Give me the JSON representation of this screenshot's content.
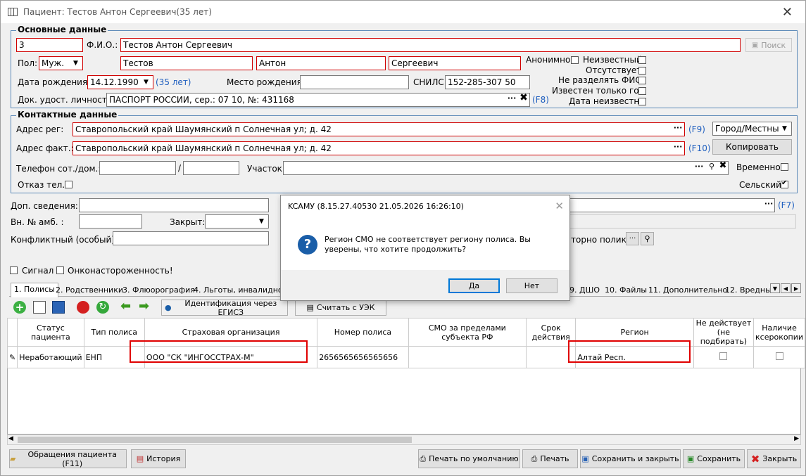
{
  "window": {
    "title": "Пациент: Тестов Антон Сергеевич(35 лет)"
  },
  "main_group": {
    "label": "Основные данные",
    "id_value": "3",
    "fio_label": "Ф.И.О.:",
    "fio_value": "Тестов Антон Сергеевич",
    "search_button": "Поиск",
    "sex_label": "Пол:",
    "sex_value": "Муж.",
    "last_name": "Тестов",
    "first_name": "Антон",
    "middle_name": "Сергеевич",
    "birth_label": "Дата рождения:",
    "birth_value": "14.12.1990",
    "age": "(35 лет)",
    "birthplace_label": "Место рождения:",
    "birthplace_value": "",
    "snils_label": "СНИЛС:",
    "snils_value": "152-285-307 50",
    "doc_label": "Док. удост. личность:",
    "doc_value": "ПАСПОРТ РОССИИ, сер.: 07 10, №: 431168",
    "doc_hotkey": "(F8)",
    "flags": {
      "anonymous": "Анонимно",
      "unknown": "Неизвестный",
      "absent": "Отсутствует",
      "no_split_fio": "Не разделять ФИО",
      "year_only": "Известен только год",
      "date_unknown": "Дата неизвестна"
    }
  },
  "contact_group": {
    "label": "Контактные данные",
    "addr_reg_label": "Адрес рег:",
    "addr_reg_value": "Ставропольский край Шаумянский п Солнечная ул; д. 42",
    "addr_reg_hotkey": "(F9)",
    "city_select": "Город/Местный",
    "addr_fact_label": "Адрес факт.:",
    "addr_fact_value": "Ставропольский край Шаумянский п Солнечная ул; д. 42",
    "addr_fact_hotkey": "(F10)",
    "copy_button": "Копировать",
    "phone_label": "Телефон сот./дом.:",
    "phone_sep": "/",
    "district_label": "Участок:",
    "temporary_label": "Временно",
    "refuse_phone_label": "Отказ тел.",
    "rural_label": "Сельский"
  },
  "extra": {
    "dop_label": "Доп. сведения:",
    "dop_hotkey": "(F7)",
    "amb_label": "Вн. № амб. :",
    "closed_label": "Закрыт:",
    "conflict_label": "Конфликтный (особый):",
    "clinic_text": "торно поликл",
    "signal_label": "Сигнал",
    "onco_label": "Онконастороженность!"
  },
  "tabs": [
    "1. Полисы",
    "2. Родственники",
    "3. Флюорография",
    "4. Льготы, инвалидност",
    "9. ДШО",
    "10. Файлы",
    "11. Дополнительно",
    "12. Вредны"
  ],
  "toolbar": {
    "ident_button": "Идентификация через ЕГИСЗ",
    "uek_button": "Считать с УЭК"
  },
  "grid": {
    "headers": [
      "Статус пациента",
      "Тип полиса",
      "Страховая организация",
      "Номер полиса",
      "СМО за пределами субъекта РФ",
      "Срок действия",
      "Регион",
      "Не действует (не подбирать)",
      "Наличие ксерокопии"
    ],
    "row": {
      "status": "Неработающий",
      "type": "ЕНП",
      "insurer": "ООО \"СК \"ИНГОССТРАХ-М\"",
      "number": "2656565656565656",
      "smo_outside": "",
      "term": "",
      "region": "Алтай Респ."
    }
  },
  "dialog": {
    "title": "KCAMУ (8.15.27.40530 21.05.2026 16:26:10)",
    "message": "Регион СМО не соответствует региону полиса. Вы уверены, что хотите продолжить?",
    "yes": "Да",
    "no": "Нет"
  },
  "bottom": {
    "visits_button": "Обращения пациента (F11)",
    "history_button": "История",
    "print_default_button": "Печать по умолчанию",
    "print_button": "Печать",
    "save_close_button": "Сохранить и закрыть",
    "save_button": "Сохранить",
    "close_button": "Закрыть"
  },
  "colors": {
    "accent_red": "#e00000",
    "link_blue": "#1f5fbf",
    "dialog_icon": "#1a5ea8"
  }
}
